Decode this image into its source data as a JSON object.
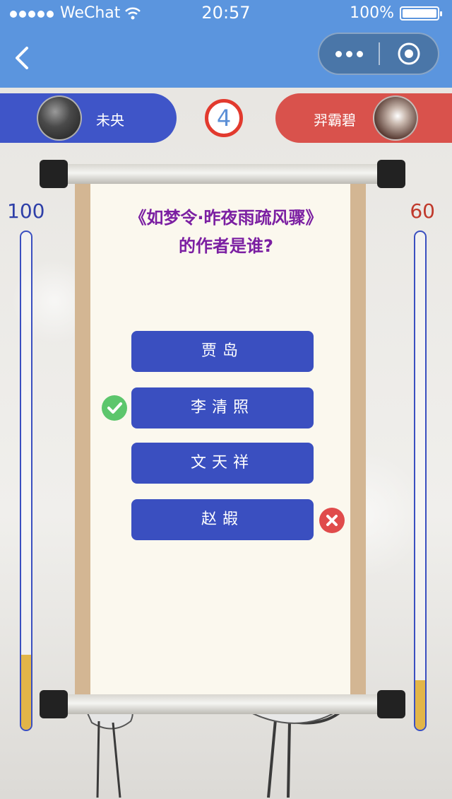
{
  "status": {
    "carrier": "WeChat",
    "time": "20:57",
    "battery": "100%"
  },
  "icons": {
    "back": "back-chevron-icon",
    "more": "more-dots-icon",
    "target": "target-icon",
    "correct": "check-circle-icon",
    "wrong": "cross-circle-icon"
  },
  "players": {
    "me": {
      "name": "未央",
      "score": "100",
      "fill_fraction": 0.15
    },
    "opponent": {
      "name": "羿霸碧",
      "score": "60",
      "fill_fraction": 0.1
    }
  },
  "round": "4",
  "question": {
    "line1": "《如梦令·昨夜雨疏风骤》",
    "line2": "的作者是谁?"
  },
  "options": [
    {
      "label": "贾岛",
      "state": "normal"
    },
    {
      "label": "李清照",
      "state": "correct"
    },
    {
      "label": "文天祥",
      "state": "normal"
    },
    {
      "label": "赵嘏",
      "state": "wrong"
    }
  ],
  "colors": {
    "header": "#5b95de",
    "me": "#3f55c8",
    "opponent": "#d9524c",
    "option": "#3a4fc0",
    "question": "#7b1fa2",
    "correct": "#5cc66c",
    "wrong": "#e04b4b",
    "bar_fill": "#e2b548"
  }
}
